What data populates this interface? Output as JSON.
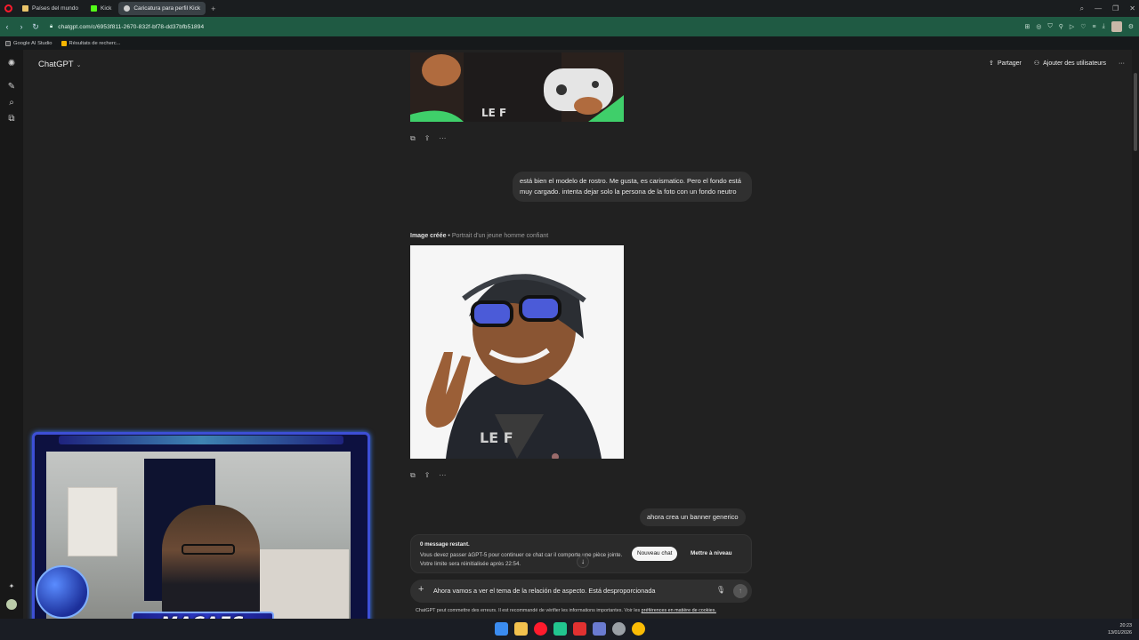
{
  "browser": {
    "tabs": [
      {
        "label": "Países del mundo",
        "active": false,
        "color": "#e9c46a"
      },
      {
        "label": "Kick",
        "active": false,
        "color": "#53fc18"
      },
      {
        "label": "Caricatura para perfil Kick",
        "active": true,
        "color": "#cfcfcf"
      }
    ],
    "url": "chatgpt.com/c/6953f811-2670-832f-bf78-dd37bfb51894",
    "bookmarks": [
      {
        "label": "Google AI Studio"
      },
      {
        "label": "Résultats de recherc..."
      }
    ]
  },
  "app": {
    "title": "ChatGPT",
    "share_label": "Partager",
    "add_users_label": "Ajouter des utilisateurs"
  },
  "chat": {
    "user_message_1": "está bien el modelo de rostro. Me gusta, es carismatico. Pero el fondo está muy cargado. intenta dejar solo la persona de la foto con un fondo neutro",
    "image_caption_prefix": "Image créée",
    "image_caption_title": "Portrait d'un jeune homme confiant",
    "user_message_2": "ahora crea un banner generico"
  },
  "limit": {
    "title": "0 message restant.",
    "body": "Vous devez passer àGPT-5 pour continuer ce chat car il comporte une pièce jointe. Votre limite sera réinitialisée après 22:54.",
    "new_chat_label": "Nouveau chat",
    "upgrade_label": "Mettre à niveau"
  },
  "composer": {
    "text": "Ahora vamos a ver el tema de la relación de aspecto. Está desproporcionada"
  },
  "disclaimer": {
    "text": "ChatGPT peut commettre des erreurs. Il est recommandé de vérifier les informations importantes. Voir les ",
    "link": "préférences en matière de cookies."
  },
  "overlay": {
    "streamer_name": "MACAES"
  },
  "taskbar": {
    "time": "20:23",
    "date": "13/01/2026",
    "icon_colors": [
      "#3b8cf0",
      "#f2c14e",
      "#ff1b2d",
      "#22c58f",
      "#e03131",
      "#6a7bd1",
      "#9aa0a6",
      "#fbbc05"
    ]
  }
}
